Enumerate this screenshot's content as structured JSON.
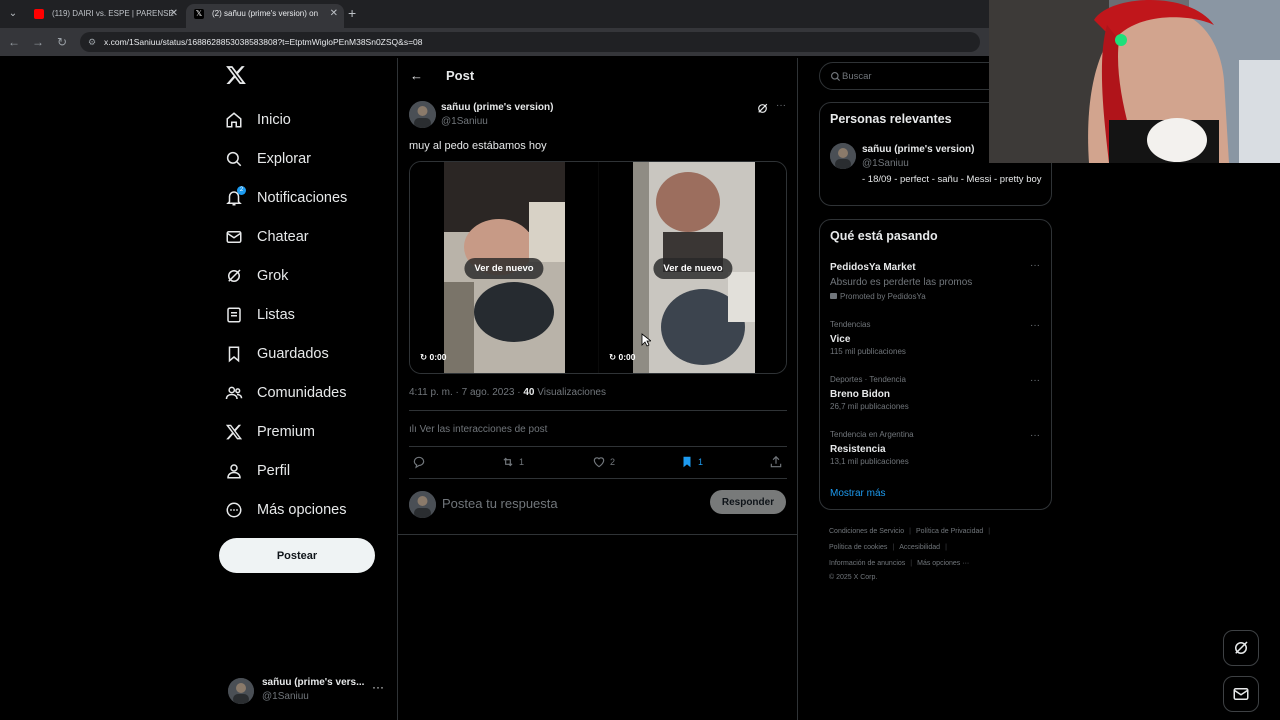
{
  "browser": {
    "tabs": [
      {
        "title": "(119) DAIRI vs. ESPE | PARENSE",
        "favicon": "youtube-icon",
        "active": false
      },
      {
        "title": "(2) sañuu (prime's version) on",
        "favicon": "x-icon",
        "active": true
      }
    ],
    "url": "x.com/1Saniuu/status/1688628853038583808?t=EtptmWigloPEnM38Sn0ZSQ&s=08"
  },
  "sidebar": {
    "items": [
      {
        "label": "Inicio",
        "icon": "home-icon"
      },
      {
        "label": "Explorar",
        "icon": "search-icon"
      },
      {
        "label": "Notificaciones",
        "icon": "bell-icon",
        "badge": "2"
      },
      {
        "label": "Chatear",
        "icon": "mail-icon"
      },
      {
        "label": "Grok",
        "icon": "grok-icon"
      },
      {
        "label": "Listas",
        "icon": "list-icon"
      },
      {
        "label": "Guardados",
        "icon": "bookmark-icon"
      },
      {
        "label": "Comunidades",
        "icon": "communities-icon"
      },
      {
        "label": "Premium",
        "icon": "x-icon"
      },
      {
        "label": "Perfil",
        "icon": "person-icon"
      },
      {
        "label": "Más opciones",
        "icon": "more-circle-icon"
      }
    ],
    "post_button": "Postear",
    "account": {
      "name": "sañuu (prime's vers...",
      "handle": "@1Saniuu"
    }
  },
  "main": {
    "title": "Post",
    "post": {
      "author_name": "sañuu (prime's version)",
      "author_handle": "@1Saniuu",
      "text": "muy al pedo estábamos hoy",
      "videos": [
        {
          "replay_label": "Ver de nuevo",
          "time": "0:00"
        },
        {
          "replay_label": "Ver de nuevo",
          "time": "0:00"
        }
      ],
      "timestamp": "4:11 p. m. · 7 ago. 2023 · ",
      "views_count": "40",
      "views_label": " Visualizaciones",
      "interactions_label": "Ver las interacciones de post",
      "actions": {
        "reply_count": "",
        "repost_count": "1",
        "like_count": "2",
        "bookmark_count": "1"
      }
    },
    "reply": {
      "placeholder": "Postea tu respuesta",
      "button": "Responder"
    }
  },
  "right": {
    "search_placeholder": "Buscar",
    "relevant": {
      "title": "Personas relevantes",
      "name": "sañuu (prime's version)",
      "handle": "@1Saniuu",
      "bio": "- 18/09 - perfect - sañu - Messi - pretty boy"
    },
    "trending": {
      "title": "Qué está pasando",
      "ad": {
        "title": "PedidosYa Market",
        "subtitle": "Absurdo es perderte las promos",
        "promoted": "Promoted by PedidosYa"
      },
      "items": [
        {
          "category": "Tendencias",
          "title": "Vice",
          "count": "115 mil publicaciones"
        },
        {
          "category": "Deportes · Tendencia",
          "title": "Breno Bidon",
          "count": "26,7 mil publicaciones"
        },
        {
          "category": "Tendencia en Argentina",
          "title": "Resistencia",
          "count": "13,1 mil publicaciones"
        }
      ],
      "show_more": "Mostrar más"
    },
    "footer": {
      "links": [
        "Condiciones de Servicio",
        "Política de Privacidad",
        "Política de cookies",
        "Accesibilidad",
        "Información de anuncios",
        "Más opciones ···"
      ],
      "copyright": "© 2025 X Corp."
    }
  },
  "colors": {
    "accent": "#1d9bf0",
    "background": "#000000",
    "border": "#2f3336",
    "muted": "#71767b"
  }
}
